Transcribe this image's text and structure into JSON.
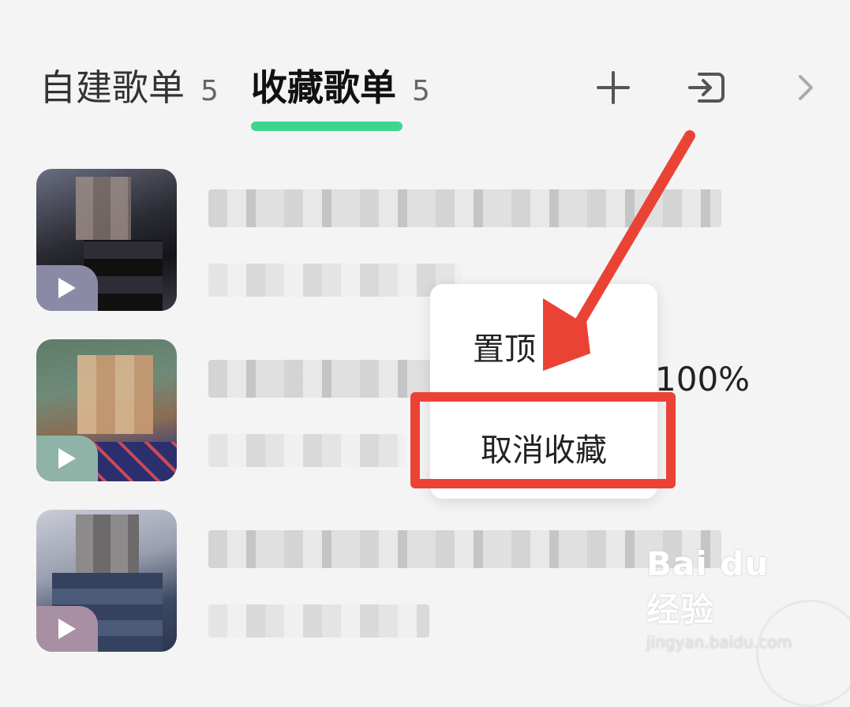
{
  "tabs": {
    "own": {
      "label": "自建歌单",
      "count": "5"
    },
    "fav": {
      "label": "收藏歌单",
      "count": "5"
    }
  },
  "colors": {
    "accent_underline": "#3dd68c",
    "highlight_red": "#ea4335"
  },
  "icons": {
    "add": "plus-icon",
    "import": "import-icon",
    "more": "chevron-right-icon",
    "play": "play-icon"
  },
  "playlists": [
    {
      "cover_hint": "dark-figure"
    },
    {
      "cover_hint": "blonde-person"
    },
    {
      "cover_hint": "blue-scarf-person"
    }
  ],
  "context_menu": {
    "pin_label": "置顶",
    "unfavorite_label": "取消收藏"
  },
  "overlay_text": {
    "percent": "100%"
  },
  "watermark": {
    "logo": "Bai du 经验",
    "url": "jingyan.baidu.com"
  }
}
